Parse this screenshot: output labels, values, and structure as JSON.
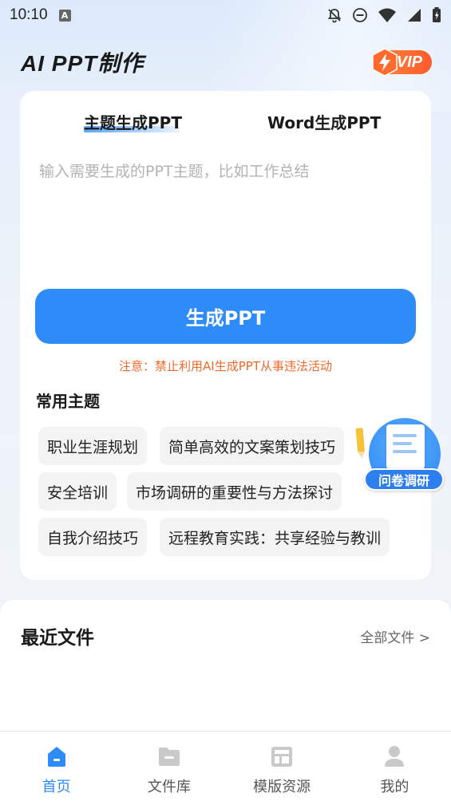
{
  "status": {
    "time": "10:10",
    "notification_letter": "A"
  },
  "header": {
    "title": "AI PPT制作",
    "vip_label": "VIP"
  },
  "generator": {
    "tabs": [
      {
        "label": "主题生成PPT",
        "active": true
      },
      {
        "label": "Word生成PPT",
        "active": false
      }
    ],
    "input_placeholder": "输入需要生成的PPT主题，比如工作总结",
    "input_value": "",
    "generate_button": "生成PPT",
    "notice": "注意：禁止利用AI生成PPT从事违法活动",
    "topics_title": "常用主题",
    "topics": [
      "职业生涯规划",
      "简单高效的文案策划技巧",
      "安全培训",
      "市场调研的重要性与方法探讨",
      "自我介绍技巧",
      "远程教育实践：共享经验与教训"
    ]
  },
  "survey": {
    "label": "问卷调研"
  },
  "recent": {
    "title": "最近文件",
    "all_files": "全部文件 >"
  },
  "nav": {
    "items": [
      {
        "label": "首页",
        "icon": "home-icon",
        "active": true
      },
      {
        "label": "文件库",
        "icon": "folder-icon",
        "active": false
      },
      {
        "label": "模版资源",
        "icon": "template-icon",
        "active": false
      },
      {
        "label": "我的",
        "icon": "user-icon",
        "active": false
      }
    ]
  },
  "colors": {
    "accent": "#2d8cf8",
    "notice": "#f06a2b",
    "vip_gradient_start": "#ff8a3d",
    "vip_gradient_end": "#ff5a2c"
  }
}
